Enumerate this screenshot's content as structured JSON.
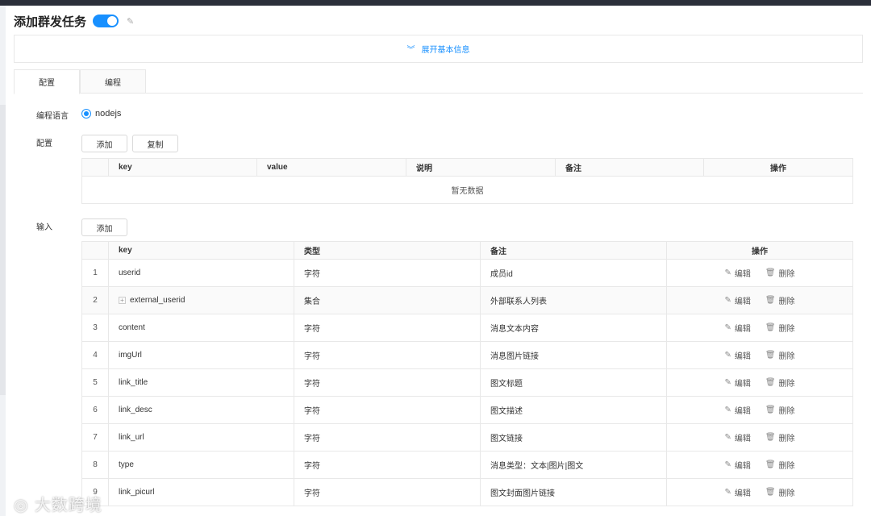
{
  "header": {
    "title": "添加群发任务",
    "toggle_on": true
  },
  "expand": {
    "label": "展开基本信息"
  },
  "tabs": [
    {
      "label": "配置",
      "active": true
    },
    {
      "label": "编程",
      "active": false
    }
  ],
  "form": {
    "lang_label": "编程语言",
    "lang_value": "nodejs",
    "config_label": "配置",
    "input_label": "输入"
  },
  "config": {
    "add_label": "添加",
    "copy_label": "复制",
    "columns": [
      "key",
      "value",
      "说明",
      "备注",
      "操作"
    ],
    "empty_text": "暂无数据"
  },
  "input": {
    "add_label": "添加",
    "columns": [
      "key",
      "类型",
      "备注",
      "操作"
    ],
    "edit_label": "编辑",
    "delete_label": "删除",
    "rows": [
      {
        "idx": "1",
        "key": "userid",
        "type": "字符",
        "note": "成员id",
        "expandable": false
      },
      {
        "idx": "2",
        "key": "external_userid",
        "type": "集合",
        "note": "外部联系人列表",
        "expandable": true
      },
      {
        "idx": "3",
        "key": "content",
        "type": "字符",
        "note": "消息文本内容",
        "expandable": false
      },
      {
        "idx": "4",
        "key": "imgUrl",
        "type": "字符",
        "note": "消息图片链接",
        "expandable": false
      },
      {
        "idx": "5",
        "key": "link_title",
        "type": "字符",
        "note": "图文标题",
        "expandable": false
      },
      {
        "idx": "6",
        "key": "link_desc",
        "type": "字符",
        "note": "图文描述",
        "expandable": false
      },
      {
        "idx": "7",
        "key": "link_url",
        "type": "字符",
        "note": "图文链接",
        "expandable": false
      },
      {
        "idx": "8",
        "key": "type",
        "type": "字符",
        "note": "消息类型：文本|图片|图文",
        "expandable": false
      },
      {
        "idx": "9",
        "key": "link_picurl",
        "type": "字符",
        "note": "图文封面图片链接",
        "expandable": false
      }
    ]
  },
  "watermark": {
    "text": "大数跨境"
  },
  "colors": {
    "accent": "#1890ff",
    "border": "#e8e8e8",
    "header_bg": "#fafafa"
  }
}
